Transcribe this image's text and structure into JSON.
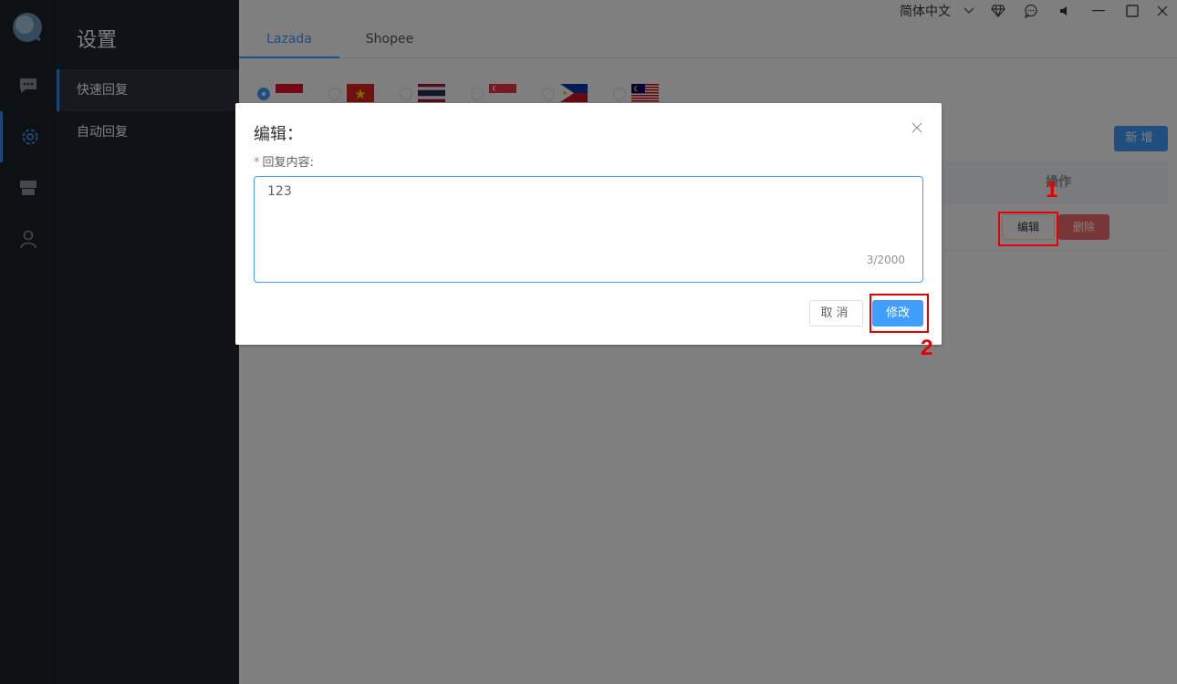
{
  "topbar": {
    "language": "简体中文"
  },
  "sidebar": {
    "title": "设置",
    "items": [
      {
        "label": "快速回复"
      },
      {
        "label": "自动回复"
      }
    ]
  },
  "tabs": [
    {
      "label": "Lazada"
    },
    {
      "label": "Shopee"
    }
  ],
  "toolbar": {
    "new_label": "新增"
  },
  "table": {
    "headers": {
      "actions": "操作"
    },
    "row_actions": {
      "edit": "编辑",
      "delete": "删除"
    }
  },
  "annotations": {
    "one": "1",
    "two": "2"
  },
  "dialog": {
    "title": "编辑：",
    "field_label": "回复内容:",
    "required_mark": "*",
    "content": "123",
    "count": "3/2000",
    "cancel_label": "取消",
    "submit_label": "修改"
  },
  "colors": {
    "accent": "#409eff",
    "danger": "#f56c6c",
    "annotation": "#e60000",
    "rail_bg": "#1c2229"
  }
}
